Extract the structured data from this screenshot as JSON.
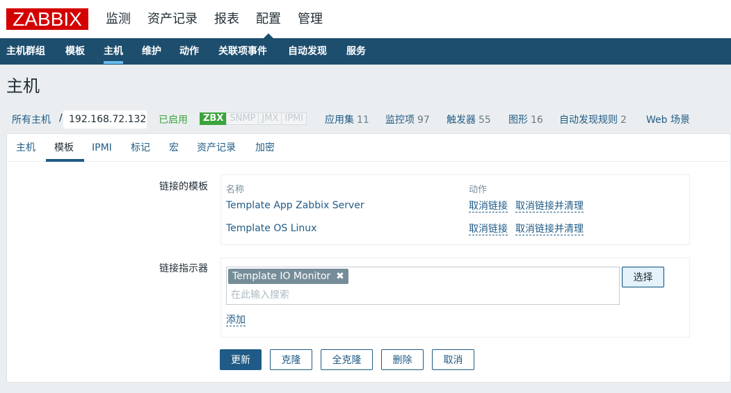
{
  "app": {
    "logo": "ZABBIX"
  },
  "main_menu": [
    "监测",
    "资产记录",
    "报表",
    "配置",
    "管理"
  ],
  "main_menu_selected": "配置",
  "submenu": [
    "主机群组",
    "模板",
    "主机",
    "维护",
    "动作",
    "关联项事件",
    "自动发现",
    "服务"
  ],
  "submenu_selected": "主机",
  "page_title": "主机",
  "host_nav": {
    "all_hosts": "所有主机",
    "separator": "/",
    "current_host": "192.168.72.132",
    "status": "已启用",
    "badges": [
      "ZBX",
      "SNMP",
      "JMX",
      "IPMI"
    ],
    "links": [
      {
        "label": "应用集",
        "count": "11"
      },
      {
        "label": "监控项",
        "count": "97"
      },
      {
        "label": "触发器",
        "count": "55"
      },
      {
        "label": "图形",
        "count": "16"
      },
      {
        "label": "自动发现规则",
        "count": "2"
      },
      {
        "label": "Web 场景",
        "count": ""
      }
    ]
  },
  "tabs": [
    "主机",
    "模板",
    "IPMI",
    "标记",
    "宏",
    "资产记录",
    "加密"
  ],
  "tab_selected": "模板",
  "linked_templates": {
    "label": "链接的模板",
    "col_name": "名称",
    "col_action": "动作",
    "rows": [
      {
        "name": "Template App Zabbix Server",
        "unlink": "取消链接",
        "unlink_clear": "取消链接并清理"
      },
      {
        "name": "Template OS Linux",
        "unlink": "取消链接",
        "unlink_clear": "取消链接并清理"
      }
    ]
  },
  "link_new": {
    "label": "链接指示器",
    "chip": "Template IO Monitor",
    "search_placeholder": "在此输入搜索",
    "select_button": "选择",
    "add_link": "添加"
  },
  "buttons": {
    "update": "更新",
    "clone": "克隆",
    "full_clone": "全克隆",
    "delete": "删除",
    "cancel": "取消"
  },
  "colors": {
    "brand": "#d40000",
    "nav": "#1e4e6e",
    "link": "#1f5b86",
    "enabled": "#3da43d"
  }
}
